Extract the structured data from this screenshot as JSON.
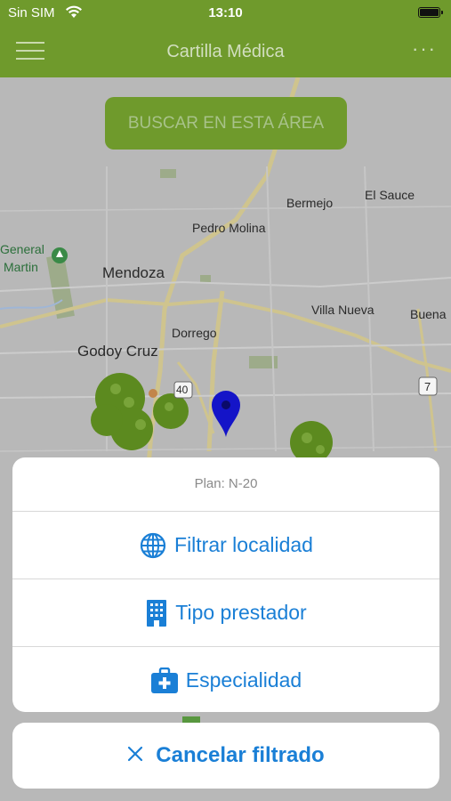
{
  "status": {
    "carrier": "Sin SIM",
    "time": "13:10"
  },
  "nav": {
    "title": "Cartilla Médica",
    "more_label": "···"
  },
  "map": {
    "search_button": "BUSCAR EN ESTA ÁREA",
    "labels": {
      "el_sauce": "El Sauce",
      "bermejo": "Bermejo",
      "pedro_molina": "Pedro Molina",
      "general": "General",
      "martin": "Martin",
      "mendoza": "Mendoza",
      "villa_nueva": "Villa Nueva",
      "buena": "Buena",
      "dorrego": "Dorrego",
      "godoy_cruz": "Godoy Cruz",
      "route_40": "40",
      "route_7": "7"
    }
  },
  "sheet": {
    "plan": "Plan: N-20",
    "actions": [
      {
        "label": "Filtrar localidad",
        "icon": "globe-icon"
      },
      {
        "label": "Tipo prestador",
        "icon": "building-icon"
      },
      {
        "label": "Especialidad",
        "icon": "medical-kit-icon"
      }
    ]
  },
  "cancel": {
    "label": "Cancelar filtrado",
    "icon": "close-icon"
  },
  "colors": {
    "brand_green": "#6f9a2c",
    "action_blue": "#1a7fd6"
  }
}
